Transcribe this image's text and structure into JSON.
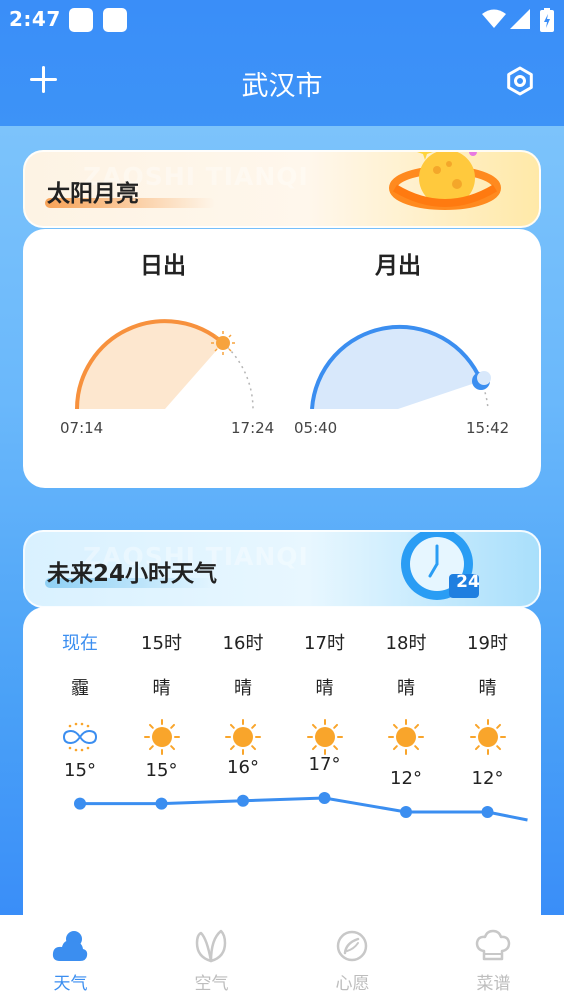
{
  "status": {
    "time": "2:47"
  },
  "header": {
    "title": "武汉市"
  },
  "sunmoon": {
    "title": "太阳月亮",
    "watermark": "ZAOSHI TIANQI",
    "sun": {
      "label": "日出",
      "rise": "07:14",
      "set": "17:24"
    },
    "moon": {
      "label": "月出",
      "rise": "05:40",
      "set": "15:42"
    }
  },
  "forecast": {
    "title": "未来24小时天气",
    "watermark": "ZAOSHI TIANQI",
    "badge": "24",
    "hours": [
      {
        "label": "现在",
        "cond": "霾",
        "temp": "15°",
        "icon": "haze-icon"
      },
      {
        "label": "15时",
        "cond": "晴",
        "temp": "15°",
        "icon": "sun-icon"
      },
      {
        "label": "16时",
        "cond": "晴",
        "temp": "16°",
        "icon": "sun-icon"
      },
      {
        "label": "17时",
        "cond": "晴",
        "temp": "17°",
        "icon": "sun-icon"
      },
      {
        "label": "18时",
        "cond": "晴",
        "temp": "12°",
        "icon": "sun-icon"
      },
      {
        "label": "19时",
        "cond": "晴",
        "temp": "12°",
        "icon": "sun-icon"
      }
    ]
  },
  "tabs": [
    {
      "label": "天气",
      "active": true
    },
    {
      "label": "空气",
      "active": false
    },
    {
      "label": "心愿",
      "active": false
    },
    {
      "label": "菜谱",
      "active": false
    }
  ],
  "colors": {
    "accent": "#3b8ef0",
    "sun": "#f7913d",
    "moon": "#3b8ef0"
  }
}
